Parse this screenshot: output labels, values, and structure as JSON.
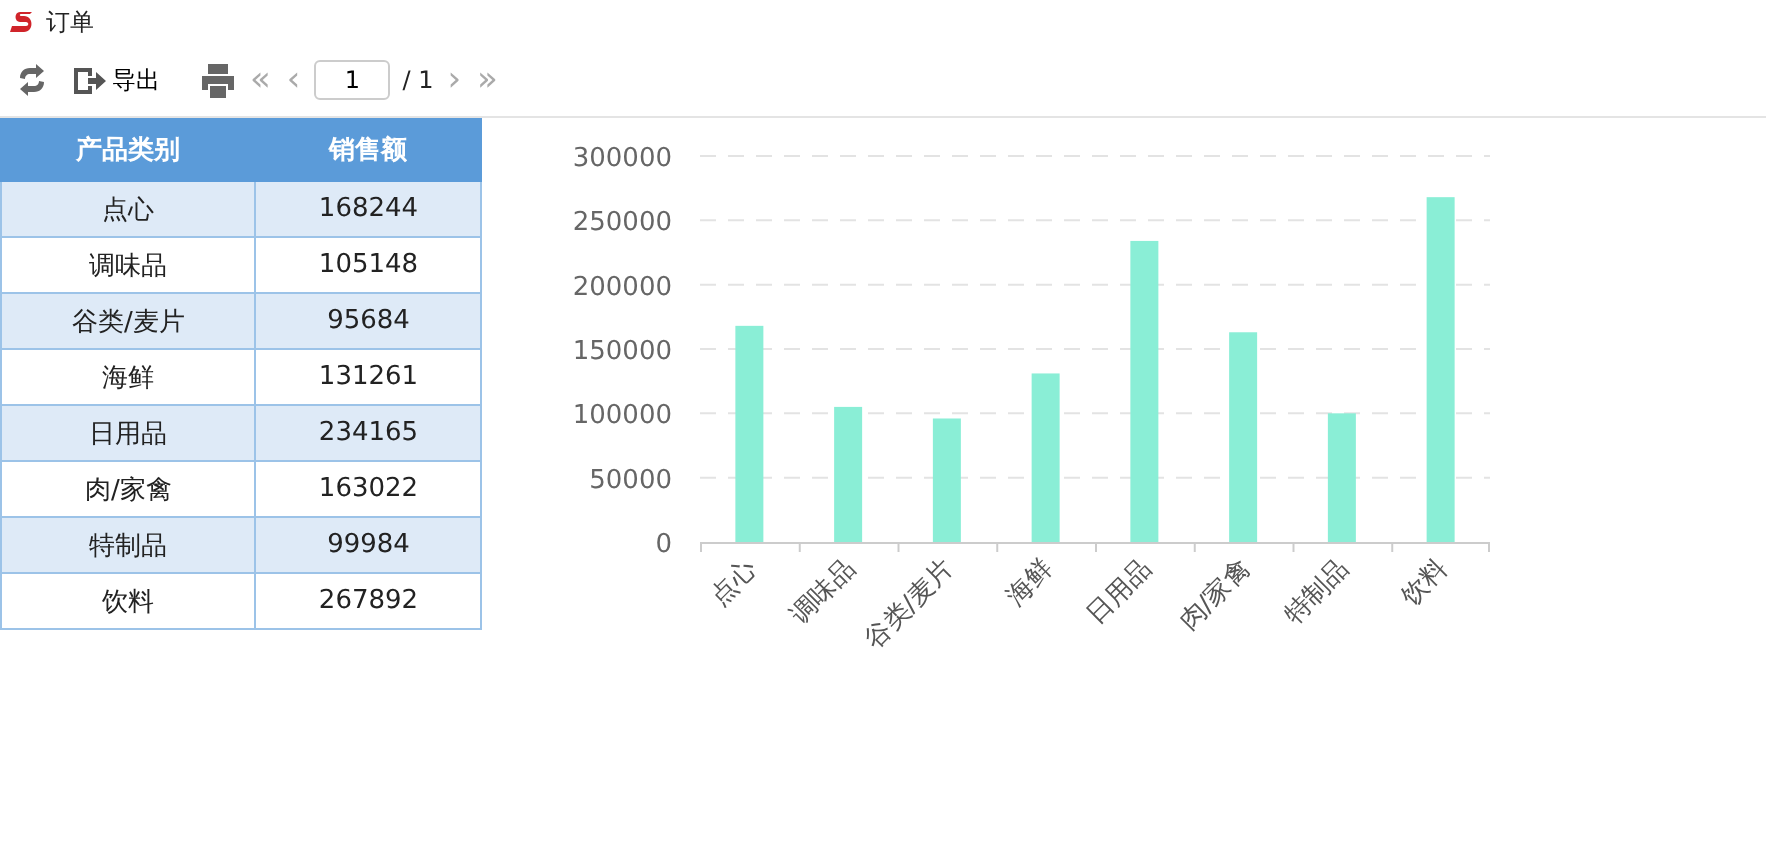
{
  "window": {
    "title": "订单"
  },
  "toolbar": {
    "export_label": "导出",
    "first": "«",
    "prev": "‹",
    "page": "1",
    "total": "/ 1",
    "next": "›",
    "last": "»"
  },
  "table": {
    "columns": [
      "产品类别",
      "销售额"
    ],
    "rows": [
      [
        "点心",
        "168244"
      ],
      [
        "调味品",
        "105148"
      ],
      [
        "谷类/麦片",
        "95684"
      ],
      [
        "海鲜",
        "131261"
      ],
      [
        "日用品",
        "234165"
      ],
      [
        "肉/家禽",
        "163022"
      ],
      [
        "特制品",
        "99984"
      ],
      [
        "饮料",
        "267892"
      ]
    ]
  },
  "chart_data": {
    "type": "bar",
    "categories": [
      "点心",
      "调味品",
      "谷类/麦片",
      "海鲜",
      "日用品",
      "肉/家禽",
      "特制品",
      "饮料"
    ],
    "values": [
      168000,
      105000,
      96000,
      131000,
      234000,
      163000,
      100000,
      268000
    ],
    "grid": true,
    "ylim": [
      0,
      300000
    ],
    "yticks": [
      0,
      50000,
      100000,
      150000,
      200000,
      250000,
      300000
    ]
  }
}
